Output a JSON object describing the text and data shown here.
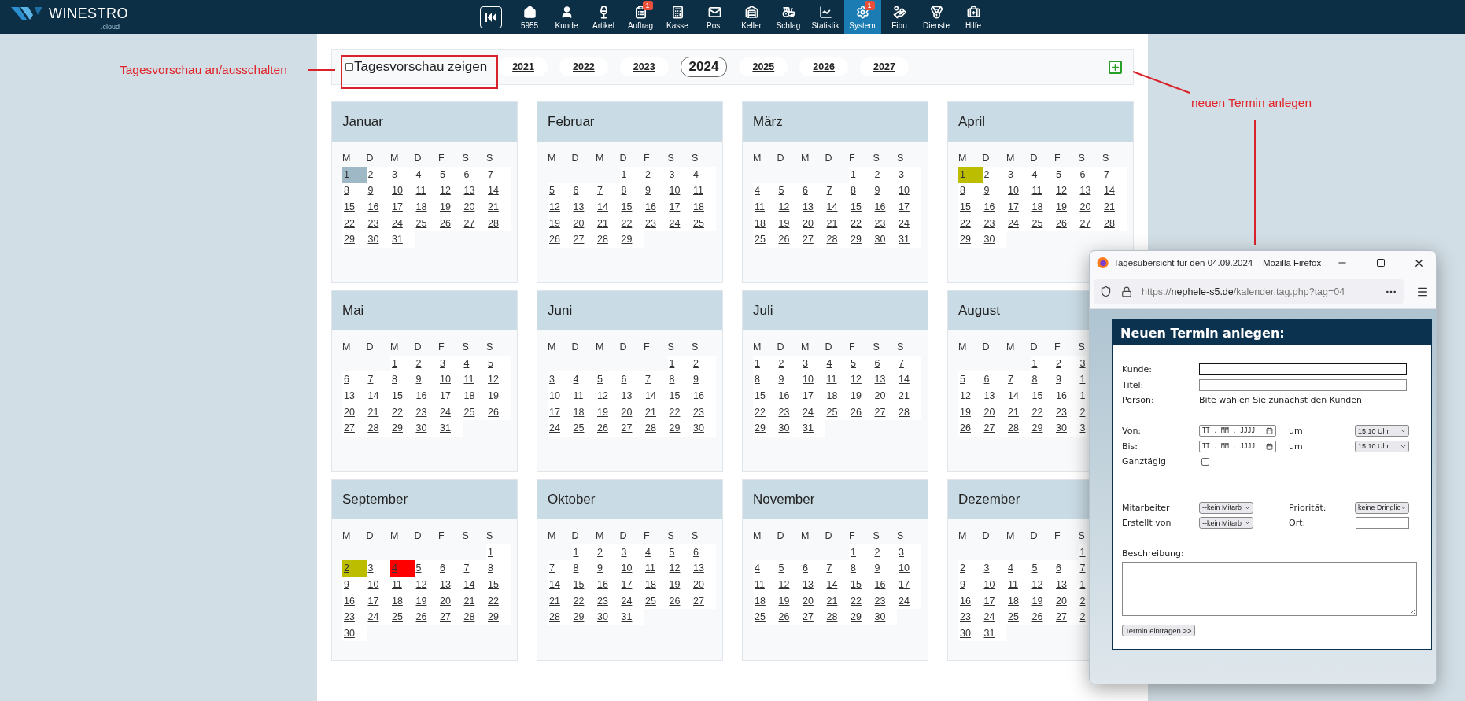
{
  "nav": {
    "logo": "WINESTRO",
    "logo_sub": ".cloud",
    "items": [
      {
        "label": "5955",
        "selected": false
      },
      {
        "label": "Kunde",
        "selected": false
      },
      {
        "label": "Artikel",
        "selected": false
      },
      {
        "label": "Auftrag",
        "selected": false,
        "badge": "1"
      },
      {
        "label": "Kasse",
        "selected": false
      },
      {
        "label": "Post",
        "selected": false
      },
      {
        "label": "Keller",
        "selected": false
      },
      {
        "label": "Schlag",
        "selected": false
      },
      {
        "label": "Statistik",
        "selected": false
      },
      {
        "label": "System",
        "selected": true,
        "badge": "1"
      },
      {
        "label": "Fibu",
        "selected": false
      },
      {
        "label": "Dienste",
        "selected": false
      },
      {
        "label": "Hilfe",
        "selected": false
      }
    ]
  },
  "toolbar": {
    "preview": {
      "label": "Tagesvorschau zeigen",
      "checked": false
    },
    "years": [
      {
        "label": "2021",
        "selected": false
      },
      {
        "label": "2022",
        "selected": false
      },
      {
        "label": "2023",
        "selected": false
      },
      {
        "label": "2024",
        "selected": true
      },
      {
        "label": "2025",
        "selected": false
      },
      {
        "label": "2026",
        "selected": false
      },
      {
        "label": "2027",
        "selected": false
      }
    ]
  },
  "annotations": [
    {
      "text": "Tagesvorschau an/ausschalten"
    },
    {
      "text": "neuen Termin anlegen"
    }
  ],
  "months": [
    {
      "name": "Januar",
      "weekdays": [
        "M",
        "D",
        "M",
        "D",
        "F",
        "S",
        "S"
      ],
      "weeks": [
        [
          {
            "label": "1",
            "color": "#9fb8c6"
          },
          "2",
          "3",
          "4",
          "5",
          "6",
          "7"
        ],
        [
          "8",
          "9",
          "10",
          "11",
          "12",
          "13",
          "14"
        ],
        [
          "15",
          "16",
          "17",
          "18",
          "19",
          "20",
          "21"
        ],
        [
          "22",
          "23",
          "24",
          "25",
          "26",
          "27",
          "28"
        ],
        [
          "29",
          "30",
          "31"
        ]
      ]
    },
    {
      "name": "Februar",
      "weekdays": [
        "M",
        "D",
        "M",
        "D",
        "F",
        "S",
        "S"
      ],
      "weeks": [
        [
          "1",
          "2",
          "3",
          "4"
        ],
        [
          "5",
          "6",
          "7",
          "8",
          "9",
          "10",
          "11"
        ],
        [
          "12",
          "13",
          "14",
          "15",
          "16",
          "17",
          "18"
        ],
        [
          "19",
          "20",
          "21",
          "22",
          "23",
          "24",
          "25"
        ],
        [
          "26",
          "27",
          "28",
          "29"
        ]
      ]
    },
    {
      "name": "März",
      "weekdays": [
        "M",
        "D",
        "M",
        "D",
        "F",
        "S",
        "S"
      ],
      "weeks": [
        [
          "1",
          "2",
          "3"
        ],
        [
          "4",
          "5",
          "6",
          "7",
          "8",
          "9",
          "10"
        ],
        [
          "11",
          "12",
          "13",
          "14",
          "15",
          "16",
          "17"
        ],
        [
          "18",
          "19",
          "20",
          "21",
          "22",
          "23",
          "24"
        ],
        [
          "25",
          "26",
          "27",
          "28",
          "29",
          "30",
          "31"
        ]
      ]
    },
    {
      "name": "April",
      "weekdays": [
        "M",
        "D",
        "M",
        "D",
        "F",
        "S",
        "S"
      ],
      "weeks": [
        [
          {
            "label": "1",
            "color": "#bdbd00"
          },
          "2",
          "3",
          "4",
          "5",
          "6",
          "7"
        ],
        [
          "8",
          "9",
          "10",
          "11",
          "12",
          "13",
          "14"
        ],
        [
          "15",
          "16",
          "17",
          "18",
          "19",
          "20",
          "21"
        ],
        [
          "22",
          "23",
          "24",
          "25",
          "26",
          "27",
          "28"
        ],
        [
          "29",
          "30"
        ]
      ]
    },
    {
      "name": "Mai",
      "weekdays": [
        "M",
        "D",
        "M",
        "D",
        "F",
        "S",
        "S"
      ],
      "weeks": [
        [
          "1",
          "2",
          "3",
          "4",
          "5"
        ],
        [
          "6",
          "7",
          "8",
          "9",
          "10",
          "11",
          "12"
        ],
        [
          "13",
          "14",
          "15",
          "16",
          "17",
          "18",
          "19"
        ],
        [
          "20",
          "21",
          "22",
          "23",
          "24",
          "25",
          "26"
        ],
        [
          "27",
          "28",
          "29",
          "30",
          "31"
        ]
      ]
    },
    {
      "name": "Juni",
      "weekdays": [
        "M",
        "D",
        "M",
        "D",
        "F",
        "S",
        "S"
      ],
      "weeks": [
        [
          "1",
          "2"
        ],
        [
          "3",
          "4",
          "5",
          "6",
          "7",
          "8",
          "9"
        ],
        [
          "10",
          "11",
          "12",
          "13",
          "14",
          "15",
          "16"
        ],
        [
          "17",
          "18",
          "19",
          "20",
          "21",
          "22",
          "23"
        ],
        [
          "24",
          "25",
          "26",
          "27",
          "28",
          "29",
          "30"
        ]
      ]
    },
    {
      "name": "Juli",
      "weekdays": [
        "M",
        "D",
        "M",
        "D",
        "F",
        "S",
        "S"
      ],
      "weeks": [
        [
          "1",
          "2",
          "3",
          "4",
          "5",
          "6",
          "7"
        ],
        [
          "8",
          "9",
          "10",
          "11",
          "12",
          "13",
          "14"
        ],
        [
          "15",
          "16",
          "17",
          "18",
          "19",
          "20",
          "21"
        ],
        [
          "22",
          "23",
          "24",
          "25",
          "26",
          "27",
          "28"
        ],
        [
          "29",
          "30",
          "31"
        ]
      ]
    },
    {
      "name": "August",
      "weekdays": [
        "M",
        "D",
        "M",
        "D",
        "F",
        "S"
      ],
      "weeks": [
        [
          "1",
          "2",
          "3"
        ],
        [
          "5",
          "6",
          "7",
          "8",
          "9",
          "1"
        ],
        [
          "12",
          "13",
          "14",
          "15",
          "16",
          "1"
        ],
        [
          "19",
          "20",
          "21",
          "22",
          "23",
          "2"
        ],
        [
          "26",
          "27",
          "28",
          "29",
          "30",
          "3"
        ]
      ]
    },
    {
      "name": "September",
      "weekdays": [
        "M",
        "D",
        "M",
        "D",
        "F",
        "S",
        "S"
      ],
      "weeks": [
        [
          "1"
        ],
        [
          {
            "label": "2",
            "color": "#bdbd00"
          },
          "3",
          {
            "label": "4",
            "color": "#ff0000"
          },
          "5",
          "6",
          "7",
          "8"
        ],
        [
          "9",
          "10",
          "11",
          "12",
          "13",
          "14",
          "15"
        ],
        [
          "16",
          "17",
          "18",
          "19",
          "20",
          "21",
          "22"
        ],
        [
          "23",
          "24",
          "25",
          "26",
          "27",
          "28",
          "29"
        ],
        [
          "30"
        ]
      ]
    },
    {
      "name": "Oktober",
      "weekdays": [
        "M",
        "D",
        "M",
        "D",
        "F",
        "S",
        "S"
      ],
      "weeks": [
        [
          "1",
          "2",
          "3",
          "4",
          "5",
          "6"
        ],
        [
          "7",
          "8",
          "9",
          "10",
          "11",
          "12",
          "13"
        ],
        [
          "14",
          "15",
          "16",
          "17",
          "18",
          "19",
          "20"
        ],
        [
          "21",
          "22",
          "23",
          "24",
          "25",
          "26",
          "27"
        ],
        [
          "28",
          "29",
          "30",
          "31"
        ]
      ]
    },
    {
      "name": "November",
      "weekdays": [
        "M",
        "D",
        "M",
        "D",
        "F",
        "S",
        "S"
      ],
      "weeks": [
        [
          "1",
          "2",
          "3"
        ],
        [
          "4",
          "5",
          "6",
          "7",
          "8",
          "9",
          "10"
        ],
        [
          "11",
          "12",
          "13",
          "14",
          "15",
          "16",
          "17"
        ],
        [
          "18",
          "19",
          "20",
          "21",
          "22",
          "23",
          "24"
        ],
        [
          "25",
          "26",
          "27",
          "28",
          "29",
          "30"
        ]
      ]
    },
    {
      "name": "Dezember",
      "weekdays": [
        "M",
        "D",
        "M",
        "D",
        "F",
        "S"
      ],
      "weeks": [
        [
          "1"
        ],
        [
          "2",
          "3",
          "4",
          "5",
          "6",
          "7"
        ],
        [
          "9",
          "10",
          "11",
          "12",
          "13",
          "1"
        ],
        [
          "16",
          "17",
          "18",
          "19",
          "20",
          "2"
        ],
        [
          "23",
          "24",
          "25",
          "26",
          "27",
          "2"
        ],
        [
          "30",
          "31"
        ]
      ]
    }
  ],
  "popup": {
    "title": "Tagesübersicht für den 04.09.2024 – Mozilla Firefox",
    "url": {
      "scheme": "https://",
      "host": "nephele-s5.de",
      "path": "/kalender.tag.php?tag=04"
    },
    "heading": "Neuen Termin anlegen:",
    "kunde": {
      "label": "Kunde:",
      "focused": true
    },
    "titel": {
      "label": "Titel:"
    },
    "person": {
      "label": "Person:",
      "text": "Bite wählen Sie zunächst den Kunden"
    },
    "von": {
      "label": "Von:",
      "date": "TT . MM . JJJJ",
      "at": "um",
      "time": "15:10 Uhr"
    },
    "bis": {
      "label": "Bis:",
      "date": "TT . MM . JJJJ",
      "at": "um",
      "time": "15:10 Uhr"
    },
    "ganztaegig": {
      "label": "Ganztägig",
      "checked": false
    },
    "mitarbeiter": {
      "label": "Mitarbeiter",
      "value": "--kein Mitarb",
      "side_label": "Priorität:",
      "side_value": "keine Dringlic"
    },
    "erstellt": {
      "label": "Erstellt von",
      "value": "--kein Mitarb",
      "side_label": "Ort:"
    },
    "beschreibung": {
      "label": "Beschreibung:"
    },
    "submit": "Termin eintragen >>"
  }
}
